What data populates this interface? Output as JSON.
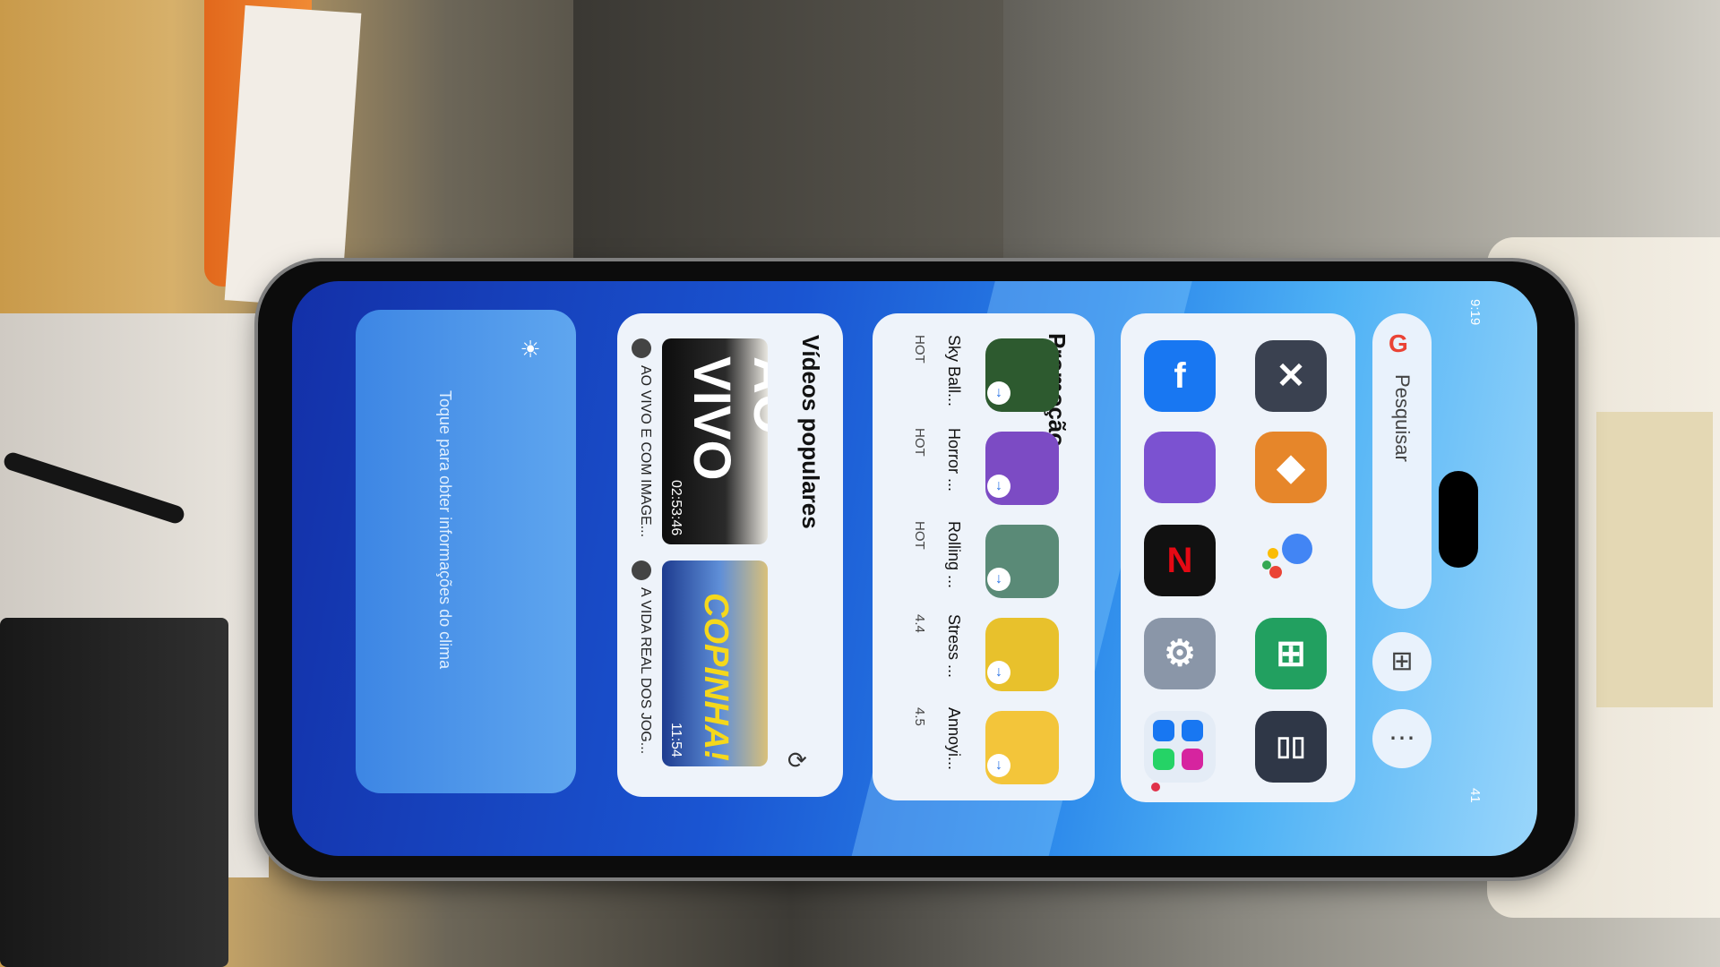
{
  "status_bar": {
    "time": "9:19",
    "battery": "41"
  },
  "weather_widget": {
    "message": "Toque para obter informações do clima",
    "icon": "weather-icon"
  },
  "videos_widget": {
    "title": "Vídeos populares",
    "items": [
      {
        "badge": "AO VIVO",
        "duration": "02:53:46",
        "caption": "AO VIVO E COM IMAGE..."
      },
      {
        "badge": "COPINHA!",
        "duration": "11:54",
        "caption": "A VIDA REAL DOS JOG..."
      }
    ]
  },
  "promo_widget": {
    "title": "Promoção",
    "items": [
      {
        "name": "Sky Ball...",
        "badge": "HOT",
        "color": "#2d5a2f"
      },
      {
        "name": "Horror ...",
        "badge": "HOT",
        "color": "#7c4bc4"
      },
      {
        "name": "Rolling ...",
        "badge": "HOT",
        "color": "#5a8a77"
      },
      {
        "name": "Stress ...",
        "badge": "4.4",
        "color": "#e8c12c"
      },
      {
        "name": "Annoyi...",
        "badge": "4.5",
        "color": "#f3c53a"
      }
    ]
  },
  "apps": {
    "facebook": {
      "label": "f",
      "color": "#1877f2"
    },
    "bubble_game": {
      "color": "#7b52d1"
    },
    "netflix": {
      "label": "N",
      "color": "#111111"
    },
    "settings": {
      "label": "⚙",
      "color": "#8a96a8"
    },
    "close_app": {
      "label": "✕",
      "color": "#3a4150"
    },
    "eraser_app": {
      "label": "◆",
      "color": "#e6862a"
    },
    "assistant": {
      "color": "#ffffff"
    },
    "add_app": {
      "label": "⊞",
      "color": "#22a060"
    },
    "split_screen": {
      "label": "▯▯",
      "color": "#2f3747"
    }
  },
  "search": {
    "placeholder": "Pesquisar",
    "logo": "G"
  },
  "buttons": {
    "widgets_label": "⊞",
    "more_label": "⋯"
  }
}
